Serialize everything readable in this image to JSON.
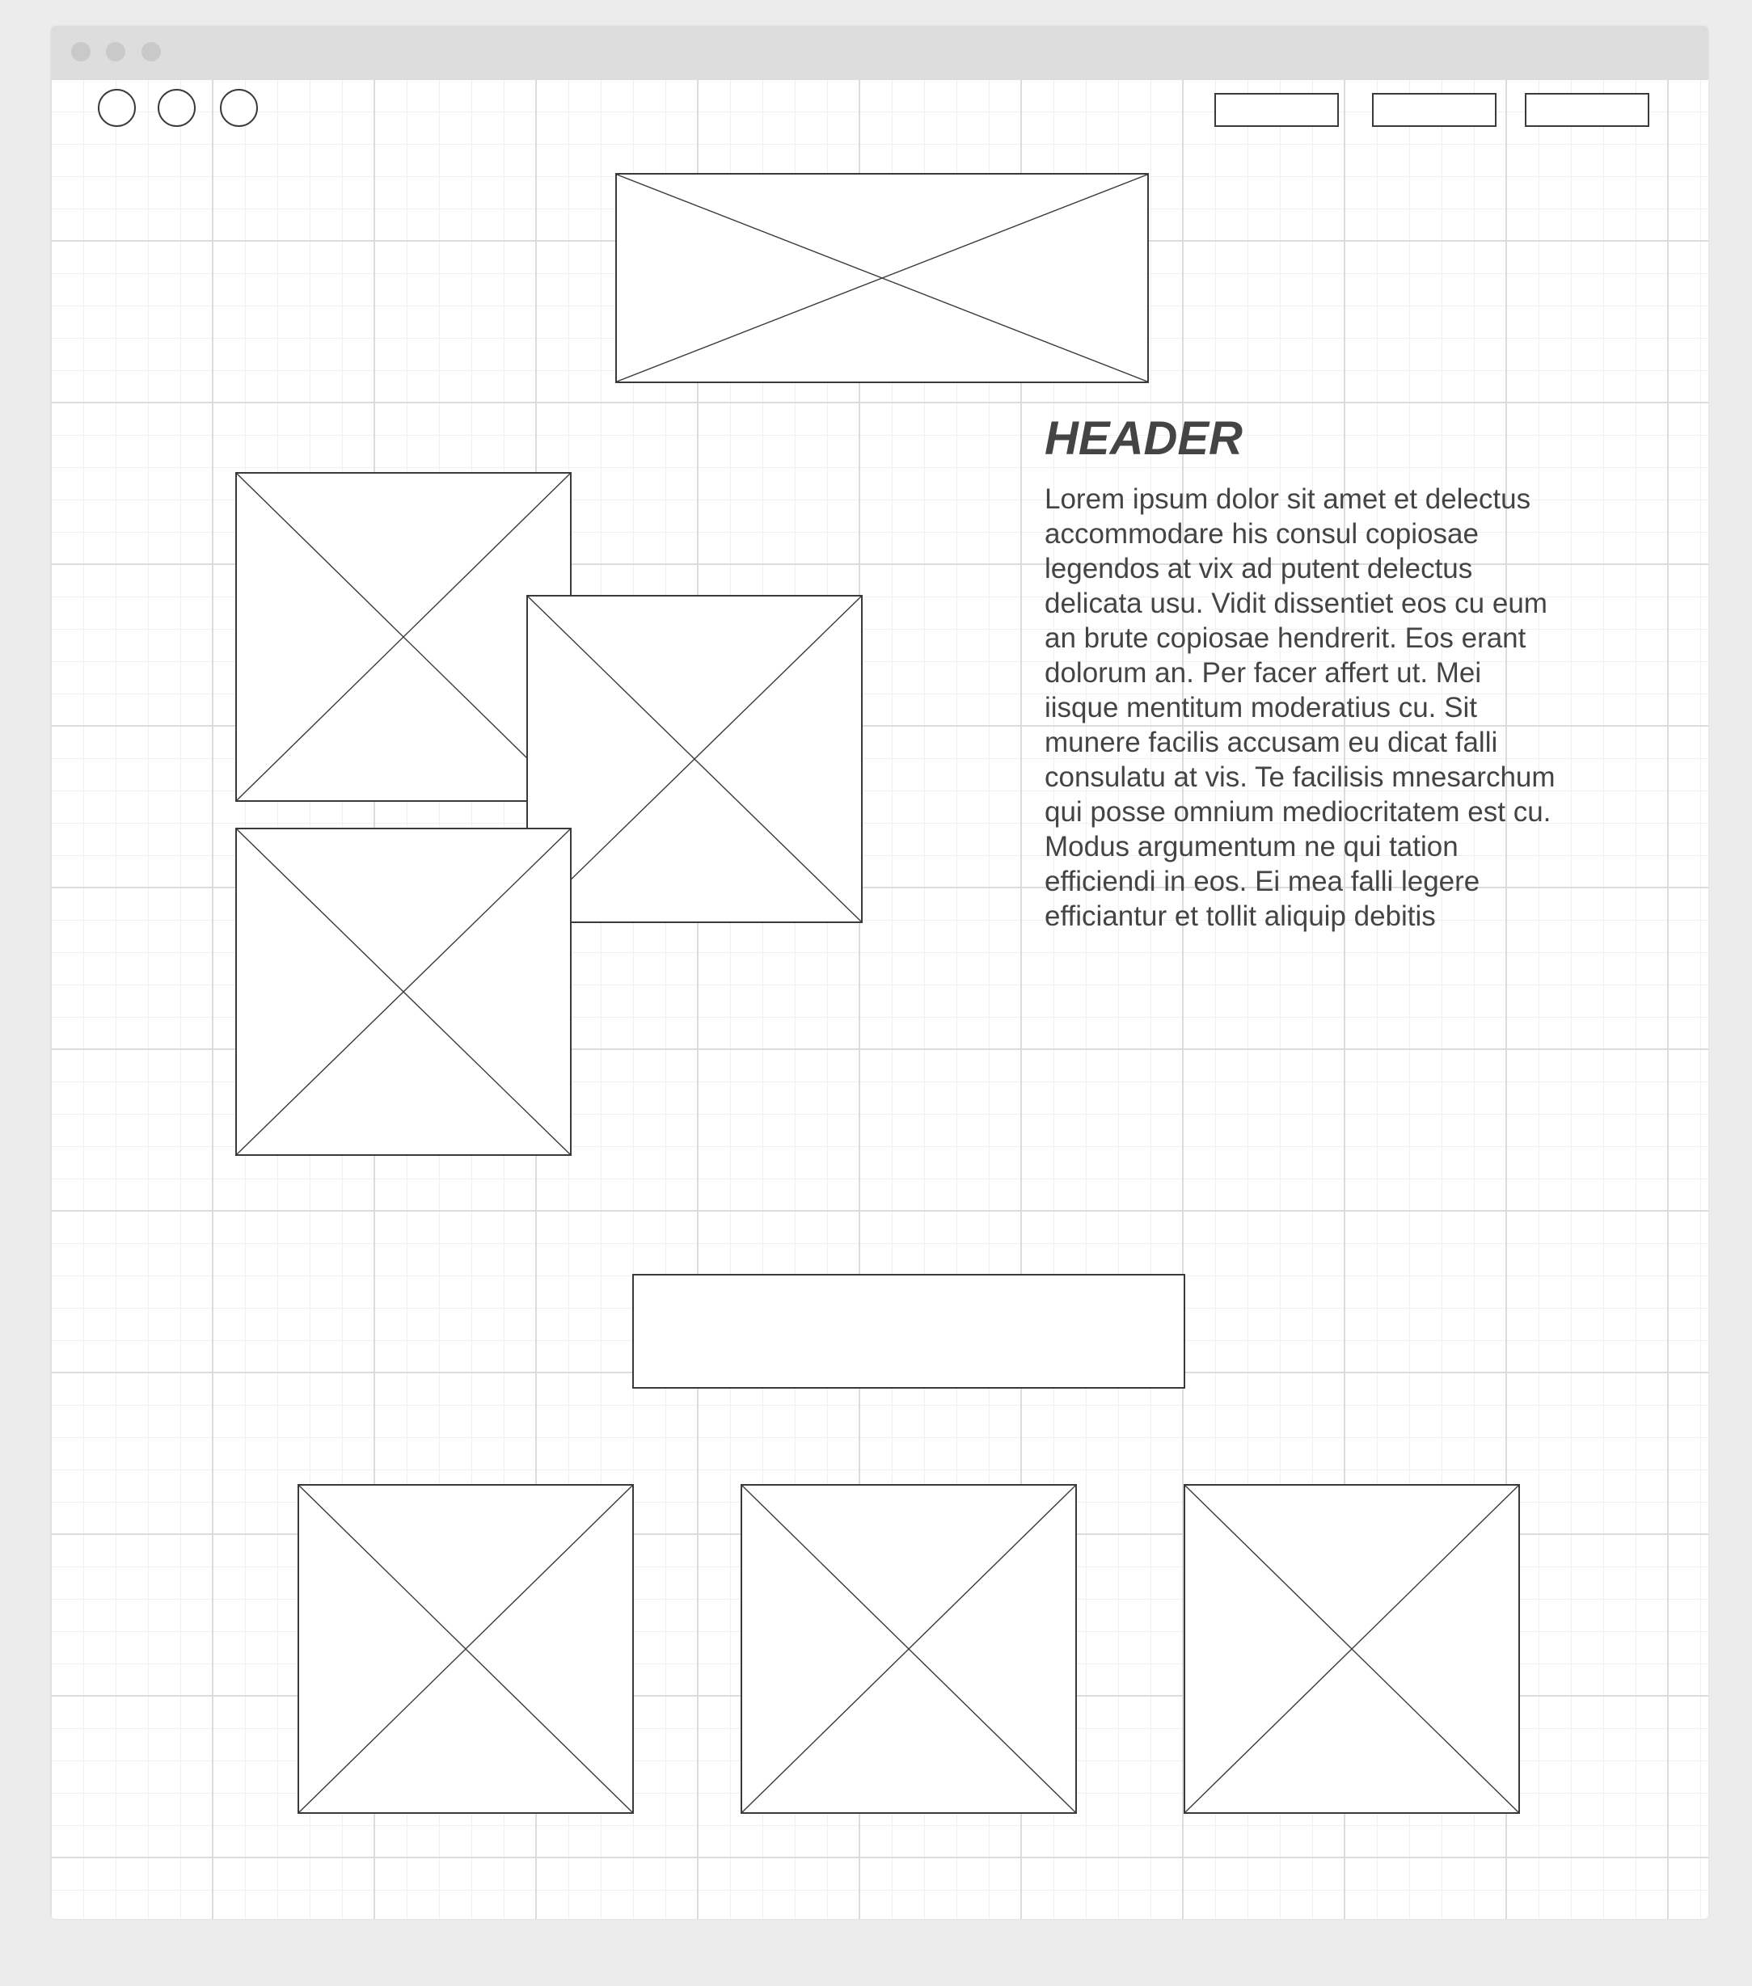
{
  "content": {
    "header": "HEADER",
    "body": "Lorem ipsum dolor sit amet et delectus accommodare his consul copiosae legendos at vix ad putent delectus delicata usu. Vidit dissentiet eos cu eum an brute copiosae hendrerit. Eos erant dolorum an. Per facer affert ut. Mei iisque mentitum moderatius cu. Sit munere facilis accusam eu dicat falli consulatu at vis. Te facilisis mnesarchum qui posse omnium mediocritatem est cu. Modus argumentum ne qui tation efficiendi in eos. Ei mea falli legere efficiantur et tollit aliquip debitis"
  },
  "icons": {
    "image_placeholder": "image-placeholder-icon",
    "social": [
      "social-icon-1",
      "social-icon-2",
      "social-icon-3"
    ]
  },
  "colors": {
    "stroke": "#3a3a3a",
    "text": "#444444",
    "titlebar": "#dddddd",
    "grid": "#dcdcdc"
  }
}
